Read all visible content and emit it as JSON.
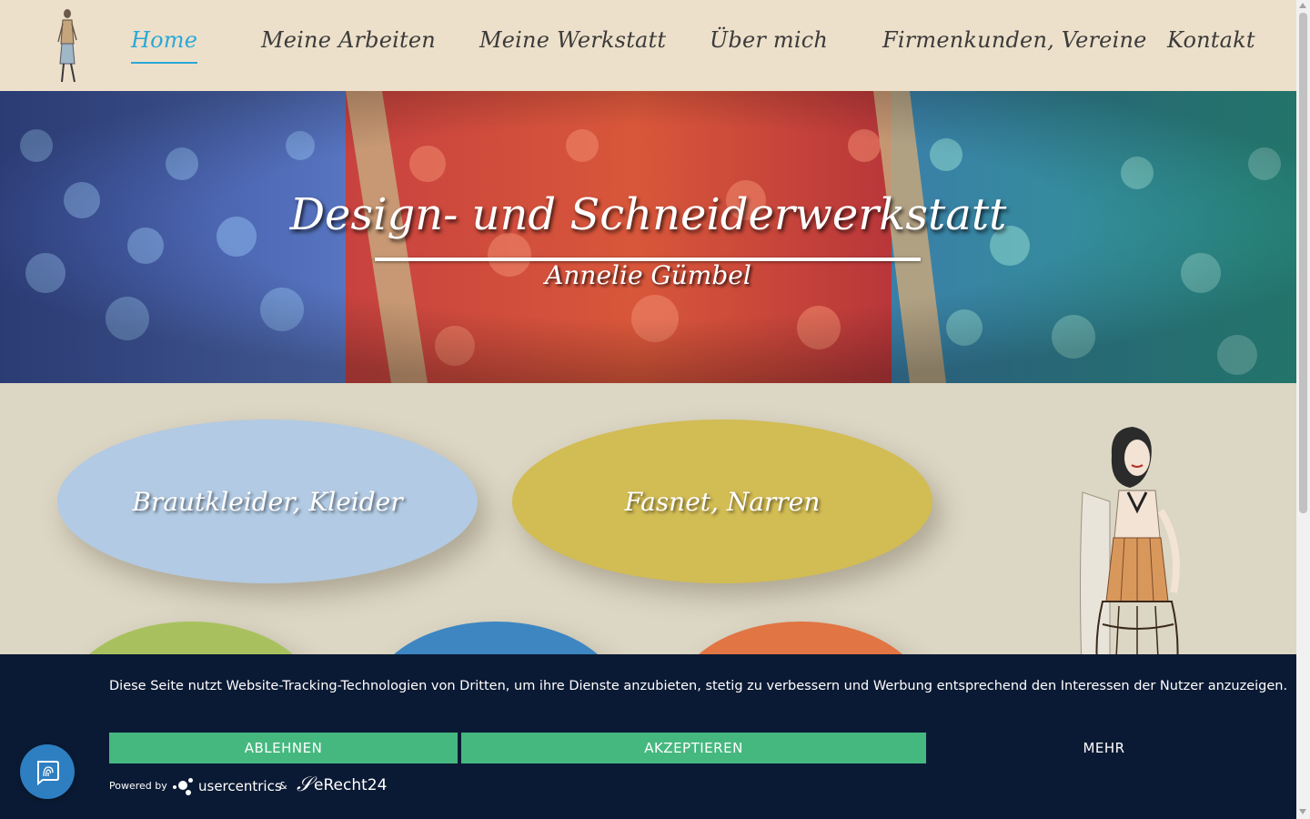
{
  "nav": {
    "items": [
      {
        "label": "Home",
        "active": true
      },
      {
        "label": "Meine Arbeiten",
        "active": false
      },
      {
        "label": "Meine Werkstatt",
        "active": false
      },
      {
        "label": "Über mich",
        "active": false
      },
      {
        "label": "Firmenkunden, Vereine",
        "active": false
      },
      {
        "label": "Kontakt",
        "active": false
      }
    ],
    "active_color": "#2aa8d6"
  },
  "hero": {
    "title": "Design- und Schneiderwerkstatt",
    "subtitle": "Annelie Gümbel"
  },
  "categories": [
    {
      "label": "Brautkleider, Kleider",
      "color": "#b2cae3"
    },
    {
      "label": "Fasnet, Narren",
      "color": "#d2bc54"
    },
    {
      "label": "",
      "color": "#a8c15e"
    },
    {
      "label": "",
      "color": "#3d86c2"
    },
    {
      "label": "",
      "color": "#e17543"
    }
  ],
  "cookie": {
    "text": "Diese Seite nutzt Website-Tracking-Technologien von Dritten, um ihre Dienste anzubieten, stetig zu verbessern und Werbung entsprechend den Interessen der Nutzer anzuzeigen.",
    "decline_label": "ABLEHNEN",
    "accept_label": "AKZEPTIEREN",
    "more_label": "MEHR",
    "powered_by": "Powered by",
    "usercentrics": "usercentrics",
    "ampersand": "&",
    "erecht": "eRecht24",
    "button_color": "#45b87f"
  }
}
